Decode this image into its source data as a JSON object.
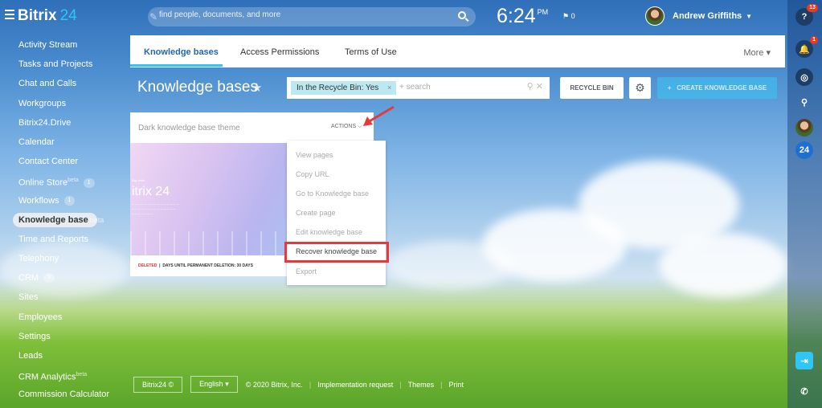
{
  "app": {
    "logo": "Bitrix",
    "logo_num": "24"
  },
  "search": {
    "placeholder": "find people, documents, and more"
  },
  "clock": {
    "time": "6:24",
    "ampm": "PM",
    "flag_count": "0"
  },
  "user": {
    "name": "Andrew Griffiths"
  },
  "rightbar": {
    "help_badge": "13",
    "bell_badge": "1",
    "badge24": "24"
  },
  "sidebar": {
    "items": [
      {
        "label": "Activity Stream"
      },
      {
        "label": "Tasks and Projects"
      },
      {
        "label": "Chat and Calls"
      },
      {
        "label": "Workgroups"
      },
      {
        "label": "Bitrix24.Drive"
      },
      {
        "label": "Calendar"
      },
      {
        "label": "Contact Center"
      },
      {
        "label": "Online Store",
        "sup": "beta",
        "count": "1"
      },
      {
        "label": "Workflows",
        "count": "1"
      },
      {
        "label": "Knowledge base",
        "ghost": "beta"
      },
      {
        "label": "Time and Reports"
      },
      {
        "label": "Telephony"
      },
      {
        "label": "CRM",
        "count": "5"
      },
      {
        "label": "Sites"
      },
      {
        "label": "Employees"
      },
      {
        "label": "Settings"
      },
      {
        "label": "Leads"
      },
      {
        "label": "CRM Analytics",
        "sup": "beta"
      },
      {
        "label": "Commission Calculator"
      }
    ]
  },
  "tabs": {
    "items": [
      "Knowledge bases",
      "Access Permissions",
      "Terms of Use"
    ],
    "more": "More"
  },
  "toolbar": {
    "title": "Knowledge bases",
    "filter_chip": "In the Recycle Bin: Yes",
    "filter_placeholder": "+ search",
    "recycle_bin": "RECYCLE BIN",
    "create": "CREATE KNOWLEDGE BASE"
  },
  "card": {
    "title": "Dark knowledge base theme",
    "actions": "ACTIONS",
    "preview_small": "Say hello",
    "preview_logo": "itrix 24",
    "deleted": "DELETED",
    "days": "DAYS UNTIL PERMANENT DELETION: 30 DAYS"
  },
  "menu": {
    "items": [
      "View pages",
      "Copy URL",
      "Go to Knowledge base",
      "Create page",
      "Edit knowledge base",
      "Recover knowledge base",
      "Export"
    ]
  },
  "footer": {
    "brand": "Bitrix24",
    "lang": "English",
    "copyright": "© 2020 Bitrix, Inc.",
    "impl": "Implementation request",
    "themes": "Themes",
    "print": "Print"
  }
}
